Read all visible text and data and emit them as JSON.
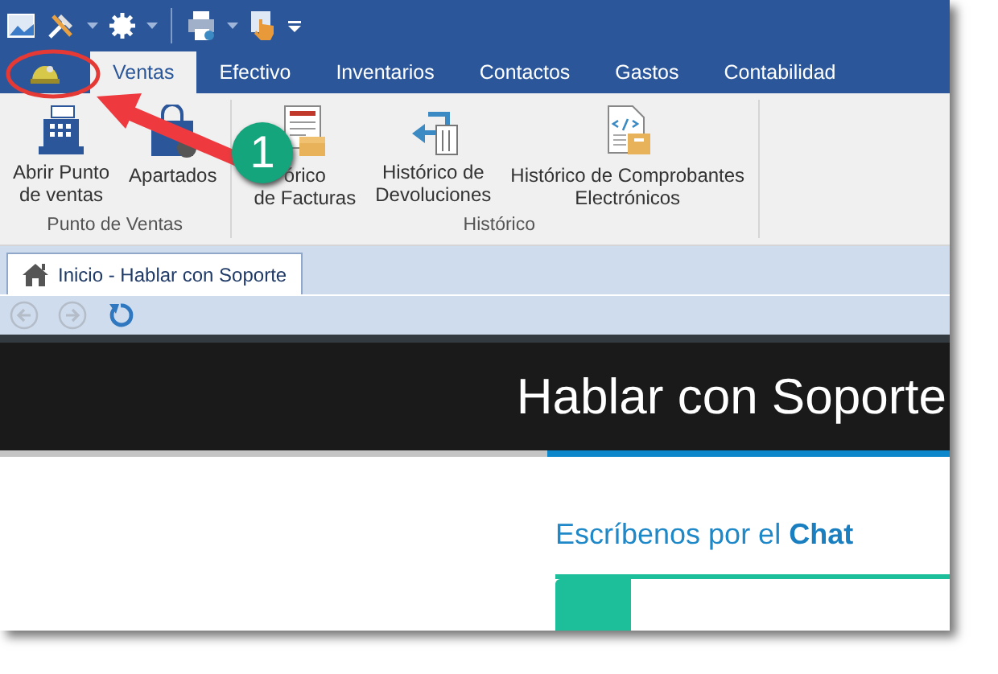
{
  "ribbon_tabs": [
    {
      "label": "Ventas",
      "selected": true
    },
    {
      "label": "Efectivo",
      "selected": false
    },
    {
      "label": "Inventarios",
      "selected": false
    },
    {
      "label": "Contactos",
      "selected": false
    },
    {
      "label": "Gastos",
      "selected": false
    },
    {
      "label": "Contabilidad",
      "selected": false
    }
  ],
  "ribbon_groups": [
    {
      "label": "Punto de Ventas",
      "buttons": [
        {
          "kind": "register",
          "lines": [
            "Abrir Punto",
            "de ventas"
          ]
        },
        {
          "kind": "bag",
          "lines": [
            "Apartados"
          ]
        }
      ]
    },
    {
      "label": "Histórico",
      "buttons": [
        {
          "kind": "invoice",
          "lines": [
            "órico",
            "de Facturas"
          ]
        },
        {
          "kind": "return",
          "lines": [
            "Histórico de",
            "Devoluciones"
          ]
        },
        {
          "kind": "xmldoc",
          "lines": [
            "Histórico de Comprobantes",
            "Electrónicos"
          ]
        }
      ]
    }
  ],
  "document_tabs": [
    {
      "label": "Inicio - Hablar con Soporte",
      "selected": true
    }
  ],
  "navigation": [
    {
      "kind": "back",
      "disabled": true
    },
    {
      "kind": "forward",
      "disabled": true
    },
    {
      "kind": "refresh",
      "disabled": false
    }
  ],
  "banner": {
    "title": "Hablar con Soporte"
  },
  "chat_heading": "Escríbenos por el **Chat**",
  "callout": {
    "number": "1"
  }
}
